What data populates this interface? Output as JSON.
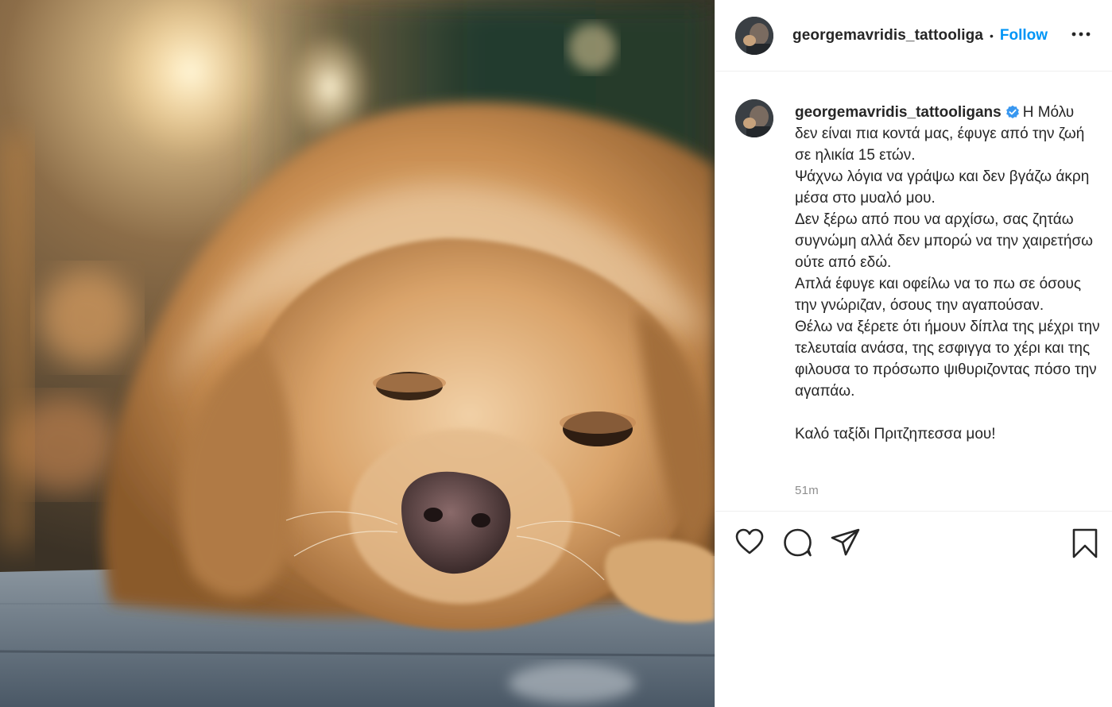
{
  "post": {
    "image_alt": "golden retriever lying on a wooden floor",
    "username": "georgemavridis_tattooligans",
    "username_header": "georgemavridis_tattooliga",
    "follow_label": "Follow",
    "separator": "•",
    "verified": true,
    "caption": "Η Μόλυ δεν είναι πια κοντά μας, έφυγε από την ζωή σε ηλικία 15 ετών.\nΨάχνω λόγια να γράψω και δεν βγάζω άκρη μέσα στο μυαλό μου.\nΔεν ξέρω από που να αρχίσω, σας ζητάω συγνώμη αλλά δεν μπορώ να την χαιρετήσω ούτε από εδώ.\nΑπλά έφυγε και οφείλω να το πω σε όσους την γνώριζαν, όσους την αγαπούσαν.\nΘέλω να ξέρετε ότι ήμουν δίπλα της μέχρι την τελευταία ανάσα, της εσφιγγα το χέρι και της φιλουσα το πρόσωπο ψιθυριζοντας πόσο την αγαπάω.\n\nΚαλό ταξίδι Πριτζηπεσσα μου!",
    "timestamp": "51m"
  },
  "icons": {
    "more": "more-options-icon",
    "like": "heart-icon",
    "comment": "comment-icon",
    "share": "share-icon",
    "save": "bookmark-icon",
    "verified": "verified-badge-icon"
  },
  "colors": {
    "accent": "#0095f6",
    "muted": "#8e8e8e",
    "text": "#262626",
    "border": "#efefef"
  }
}
